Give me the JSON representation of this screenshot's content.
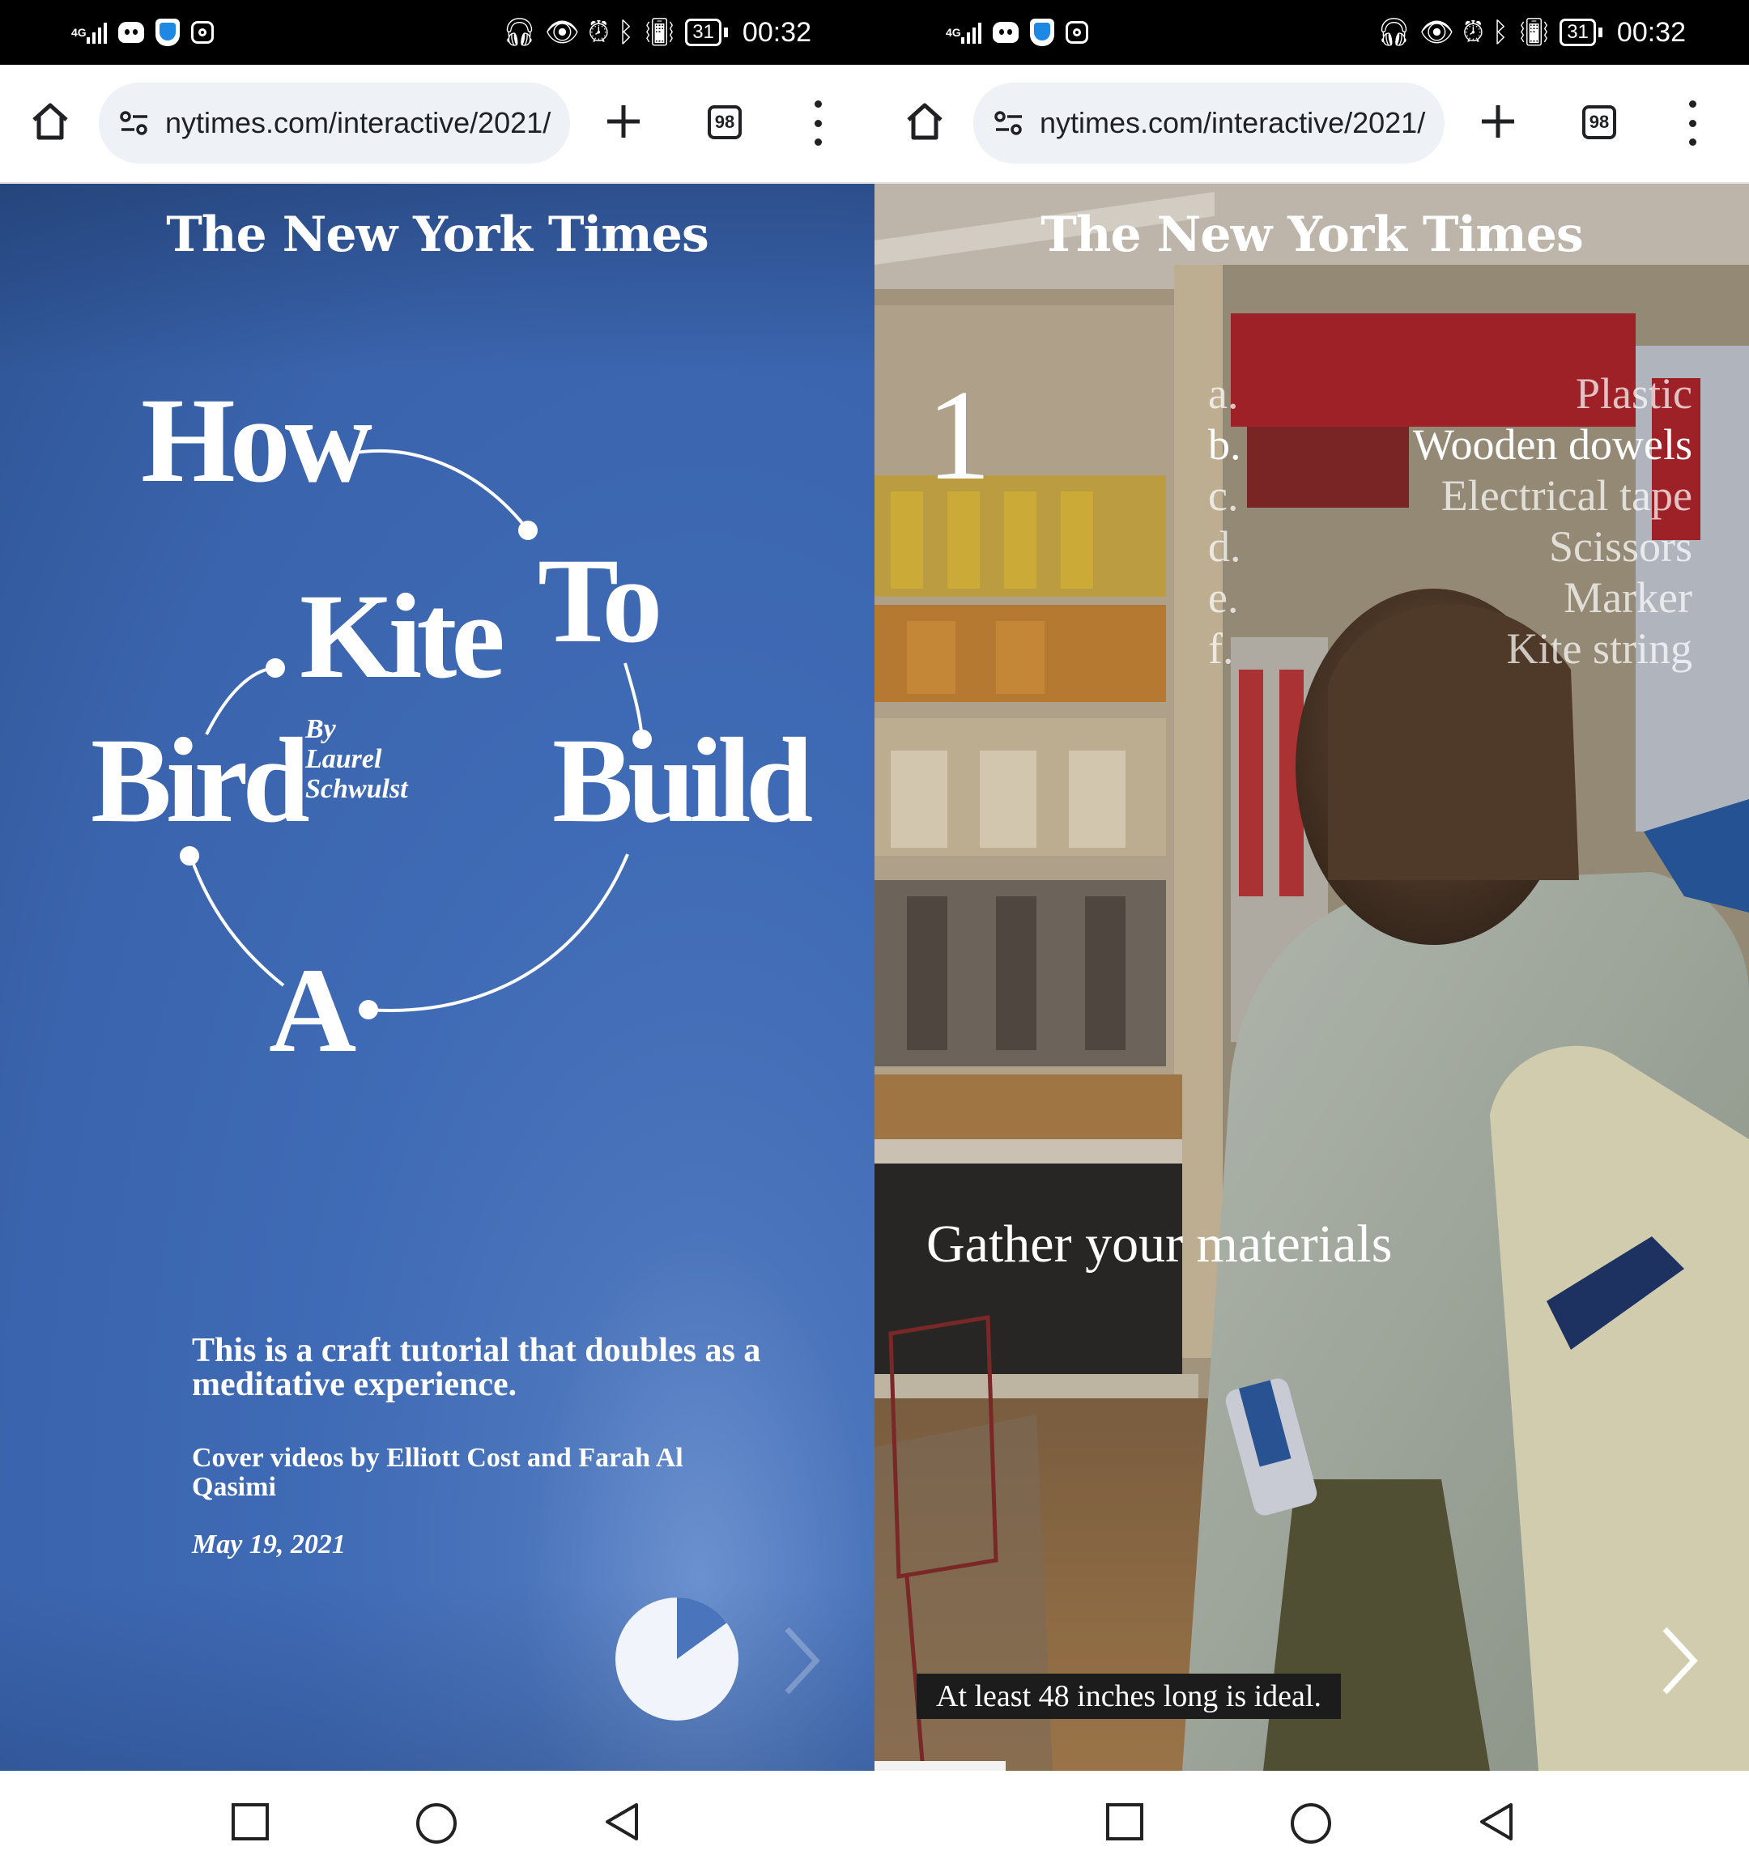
{
  "status_bar": {
    "network": "4G",
    "battery": "31",
    "time": "00:32"
  },
  "browser": {
    "url": "nytimes.com/interactive/2021/",
    "tab_count": "98"
  },
  "left_page": {
    "logo": "The New York Times",
    "title_words": {
      "how": "How",
      "to": "To",
      "build": "Build",
      "a": "A",
      "bird": "Bird",
      "kite": "Kite"
    },
    "byline": {
      "by": "By",
      "first": "Laurel",
      "last": "Schwulst"
    },
    "description": "This is a craft tutorial that doubles as a meditative experience.",
    "credit": "Cover videos by Elliott Cost and Farah Al Qasimi",
    "date": "May 19, 2021",
    "loader_progress": 0.15,
    "colors": {
      "background": "#3f6ab5",
      "text": "#ffffff"
    }
  },
  "right_page": {
    "logo": "The New York Times",
    "step_number": "1",
    "materials": [
      {
        "letter": "a.",
        "name": "Plastic"
      },
      {
        "letter": "b.",
        "name": "Wooden dowels",
        "active": true
      },
      {
        "letter": "c.",
        "name": "Electrical tape"
      },
      {
        "letter": "d.",
        "name": "Scissors"
      },
      {
        "letter": "e.",
        "name": "Marker"
      },
      {
        "letter": "f.",
        "name": "Kite string"
      }
    ],
    "heading": "Gather your materials",
    "caption": "At least 48 inches long is ideal.",
    "video_progress": 0.15
  },
  "nav_icons": [
    "recent-apps-icon",
    "home-circle-icon",
    "back-triangle-icon"
  ]
}
